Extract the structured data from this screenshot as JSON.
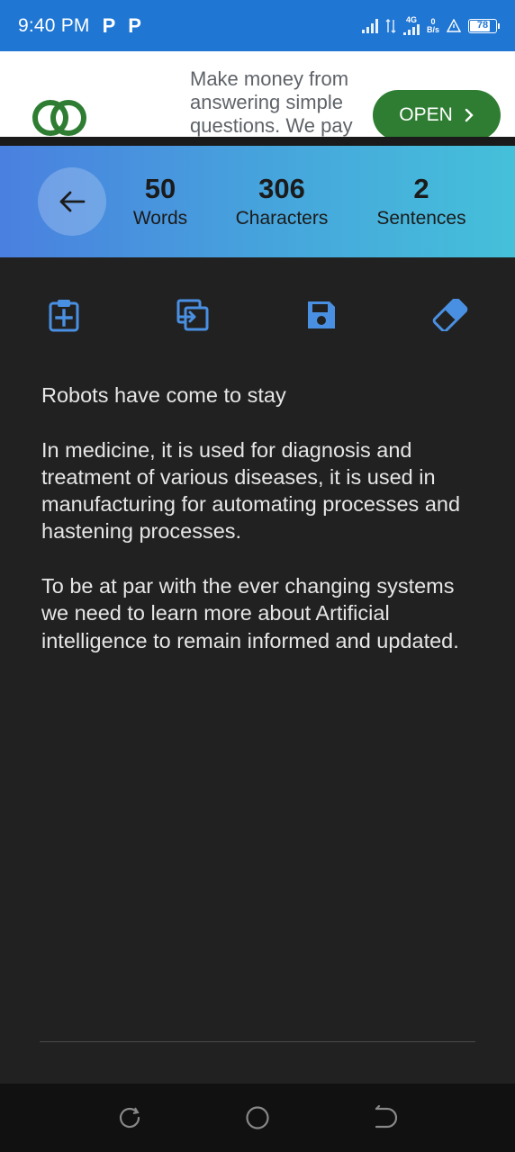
{
  "status_bar": {
    "time": "9:40 PM",
    "notif_icons": [
      "P",
      "P"
    ],
    "network_type": "4G",
    "data_rate_value": "0",
    "data_rate_unit": "B/s",
    "battery": "78"
  },
  "ad": {
    "text": "Make money from answering simple questions. We pay",
    "open_label": "OPEN",
    "logo_color": "#2e7d32"
  },
  "stats": {
    "words": {
      "value": "50",
      "label": "Words"
    },
    "characters": {
      "value": "306",
      "label": "Characters"
    },
    "sentences": {
      "value": "2",
      "label": "Sentences"
    }
  },
  "toolbar": {
    "icons": [
      "paste-icon",
      "copy-icon",
      "save-icon",
      "eraser-icon"
    ],
    "icon_color": "#4a90e2"
  },
  "editor": {
    "paragraphs": [
      "Robots have come to stay",
      "In medicine, it is used for diagnosis and treatment of various diseases, it is used in manufacturing for automating processes and hastening processes.",
      "To be at par with the ever changing systems we need to learn more about Artificial intelligence to remain informed and updated."
    ]
  },
  "colors": {
    "status_bar": "#1f76d3",
    "background": "#212121",
    "accent": "#4a90e2"
  }
}
